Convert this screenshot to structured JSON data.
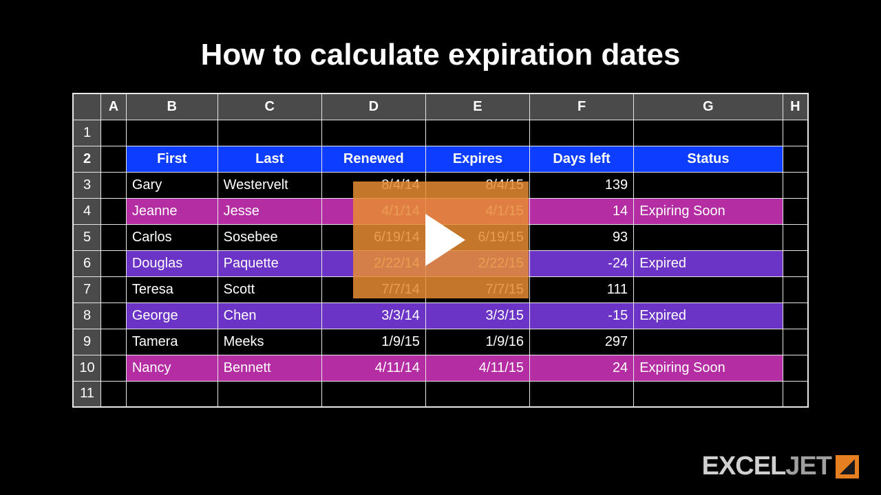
{
  "title": "How to calculate expiration dates",
  "columns": [
    "A",
    "B",
    "C",
    "D",
    "E",
    "F",
    "G",
    "H"
  ],
  "row_numbers": [
    "1",
    "2",
    "3",
    "4",
    "5",
    "6",
    "7",
    "8",
    "9",
    "10",
    "11"
  ],
  "headers": {
    "B": "First",
    "C": "Last",
    "D": "Renewed",
    "E": "Expires",
    "F": "Days left",
    "G": "Status"
  },
  "rows": [
    {
      "first": "Gary",
      "last": "Westervelt",
      "renewed": "8/4/14",
      "expires": "8/4/15",
      "days": "139",
      "status": "",
      "style": ""
    },
    {
      "first": "Jeanne",
      "last": "Jesse",
      "renewed": "4/1/14",
      "expires": "4/1/15",
      "days": "14",
      "status": "Expiring Soon",
      "style": "magenta"
    },
    {
      "first": "Carlos",
      "last": "Sosebee",
      "renewed": "6/19/14",
      "expires": "6/19/15",
      "days": "93",
      "status": "",
      "style": ""
    },
    {
      "first": "Douglas",
      "last": "Paquette",
      "renewed": "2/22/14",
      "expires": "2/22/15",
      "days": "-24",
      "status": "Expired",
      "style": "purple"
    },
    {
      "first": "Teresa",
      "last": "Scott",
      "renewed": "7/7/14",
      "expires": "7/7/15",
      "days": "111",
      "status": "",
      "style": ""
    },
    {
      "first": "George",
      "last": "Chen",
      "renewed": "3/3/14",
      "expires": "3/3/15",
      "days": "-15",
      "status": "Expired",
      "style": "purple"
    },
    {
      "first": "Tamera",
      "last": "Meeks",
      "renewed": "1/9/15",
      "expires": "1/9/16",
      "days": "297",
      "status": "",
      "style": ""
    },
    {
      "first": "Nancy",
      "last": "Bennett",
      "renewed": "4/11/14",
      "expires": "4/11/15",
      "days": "24",
      "status": "Expiring Soon",
      "style": "magenta"
    }
  ],
  "logo": {
    "part1": "EXCEL",
    "part2": "JET"
  },
  "chart_data": {
    "type": "table",
    "title": "How to calculate expiration dates",
    "columns": [
      "First",
      "Last",
      "Renewed",
      "Expires",
      "Days left",
      "Status"
    ],
    "data": [
      [
        "Gary",
        "Westervelt",
        "8/4/14",
        "8/4/15",
        139,
        ""
      ],
      [
        "Jeanne",
        "Jesse",
        "4/1/14",
        "4/1/15",
        14,
        "Expiring Soon"
      ],
      [
        "Carlos",
        "Sosebee",
        "6/19/14",
        "6/19/15",
        93,
        ""
      ],
      [
        "Douglas",
        "Paquette",
        "2/22/14",
        "2/22/15",
        -24,
        "Expired"
      ],
      [
        "Teresa",
        "Scott",
        "7/7/14",
        "7/7/15",
        111,
        ""
      ],
      [
        "George",
        "Chen",
        "3/3/14",
        "3/3/15",
        -15,
        "Expired"
      ],
      [
        "Tamera",
        "Meeks",
        "1/9/15",
        "1/9/16",
        297,
        ""
      ],
      [
        "Nancy",
        "Bennett",
        "4/11/14",
        "4/11/15",
        24,
        "Expiring Soon"
      ]
    ]
  }
}
